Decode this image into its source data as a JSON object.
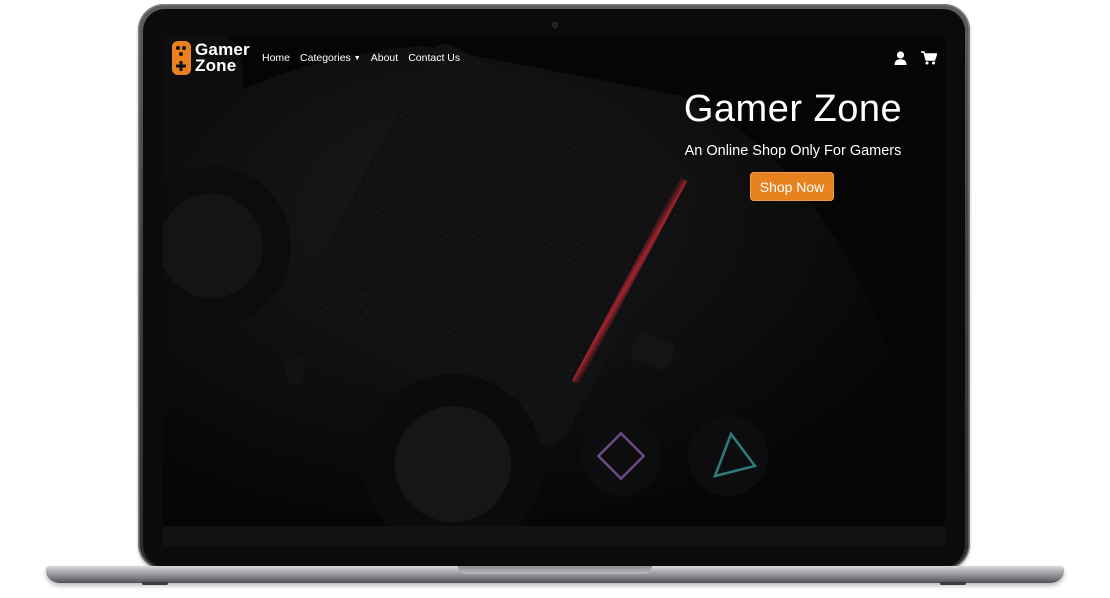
{
  "brand": {
    "line1": "Gamer",
    "line2": "Zone",
    "logo_icon": "gamepad-icon",
    "accent": "#e8821f"
  },
  "nav": {
    "items": [
      {
        "label": "Home"
      },
      {
        "label": "Categories"
      },
      {
        "label": "About"
      },
      {
        "label": "Contact Us"
      }
    ],
    "icons": [
      "user-icon",
      "cart-icon"
    ]
  },
  "hero": {
    "title": "Gamer Zone",
    "subtitle": "An Online Shop Only For Gamers",
    "cta_label": "Shop Now"
  },
  "colors": {
    "screen_bg": "#050505",
    "button": "#e8821f",
    "text": "#ffffff"
  }
}
